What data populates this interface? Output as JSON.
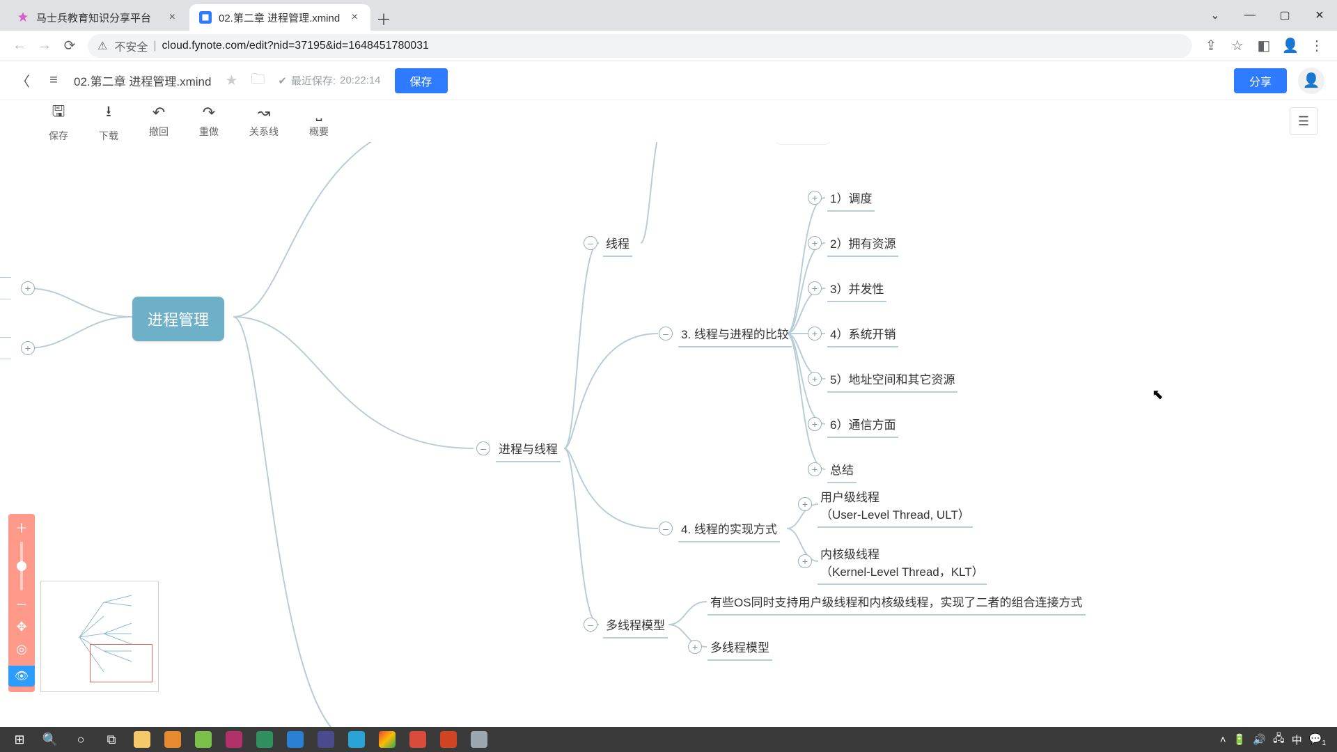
{
  "browser": {
    "tabs": [
      {
        "title": "马士兵教育知识分享平台",
        "active": false
      },
      {
        "title": "02.第二章 进程管理.xmind",
        "active": true
      }
    ],
    "url_prefix": "不安全",
    "url": "cloud.fynote.com/edit?nid=37195&id=1648451780031"
  },
  "app": {
    "filename": "02.第二章 进程管理.xmind",
    "lastsave_label": "最近保存:",
    "lastsave_time": "20:22:14",
    "save_btn": "保存",
    "share_btn": "分享"
  },
  "tools": {
    "save": "保存",
    "download": "下载",
    "undo": "撤回",
    "redo": "重做",
    "relation": "关系线",
    "summary": "概要"
  },
  "mindmap": {
    "root": "进程管理",
    "branch_procthread": "进程与线程",
    "n_thread": "线程",
    "n_compare": "3. 线程与进程的比较",
    "compare_children": {
      "c1": "1）调度",
      "c2": "2）拥有资源",
      "c3": "3）并发性",
      "c4": "4）系统开销",
      "c5": "5）地址空间和其它资源",
      "c6": "6）通信方面",
      "c7": "总结"
    },
    "n_impl": "4. 线程的实现方式",
    "impl_children": {
      "i1a": "用户级线程",
      "i1b": "（User-Level Thread, ULT）",
      "i2a": "内核级线程",
      "i2b": "（Kernel-Level Thread，KLT）"
    },
    "n_multimodel": "多线程模型",
    "multimodel_children": {
      "m1": "有些OS同时支持用户级线程和内核级线程，实现了二者的组合连接方式",
      "m2": "多线程模型"
    }
  },
  "taskbar": {
    "ime": "中",
    "notif": "1"
  }
}
